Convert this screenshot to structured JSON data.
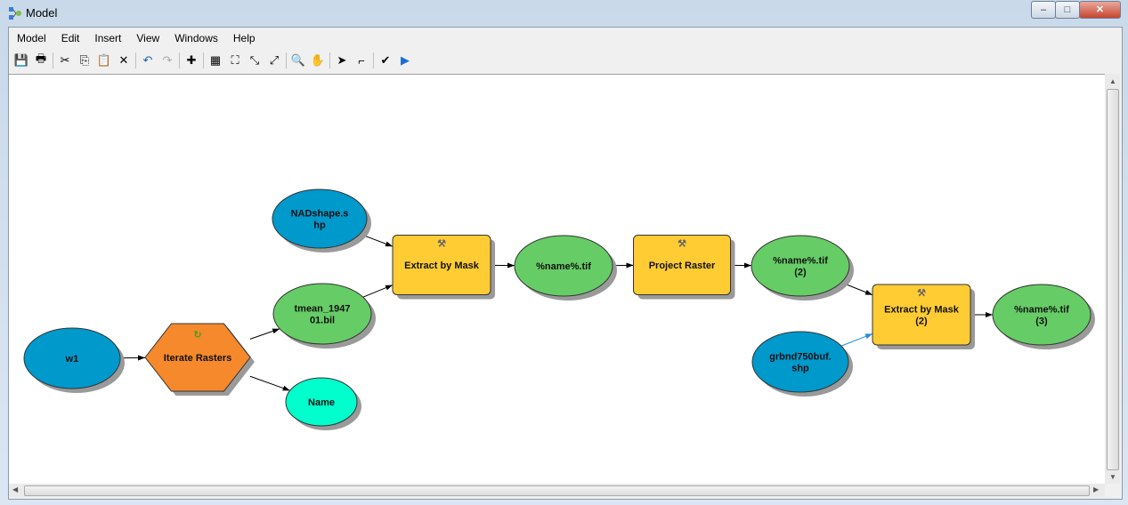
{
  "window": {
    "title": "Model",
    "minimize": "–",
    "maximize": "□",
    "close": "✕"
  },
  "menu": [
    "Model",
    "Edit",
    "Insert",
    "View",
    "Windows",
    "Help"
  ],
  "toolbar": [
    {
      "icon": "save-icon",
      "glyph": "💾"
    },
    {
      "icon": "print-icon",
      "glyph": "🖶"
    },
    "sep",
    {
      "icon": "cut-icon",
      "glyph": "✂"
    },
    {
      "icon": "copy-icon",
      "glyph": "⎘"
    },
    {
      "icon": "paste-icon",
      "glyph": "📋"
    },
    {
      "icon": "delete-icon",
      "glyph": "✕"
    },
    "sep",
    {
      "icon": "undo-icon",
      "glyph": "↶"
    },
    {
      "icon": "redo-icon",
      "glyph": "↷"
    },
    "sep",
    {
      "icon": "add-data-icon",
      "glyph": "✚"
    },
    "sep",
    {
      "icon": "auto-layout-icon",
      "glyph": "▦"
    },
    {
      "icon": "full-extent-icon",
      "glyph": "⛶"
    },
    {
      "icon": "fixed-zoom-in-icon",
      "glyph": "⤡"
    },
    {
      "icon": "fixed-zoom-out-icon",
      "glyph": "⤢"
    },
    "sep",
    {
      "icon": "zoom-in-icon",
      "glyph": "🔍"
    },
    {
      "icon": "pan-icon",
      "glyph": "✋"
    },
    "sep",
    {
      "icon": "select-icon",
      "glyph": "➤"
    },
    {
      "icon": "connect-icon",
      "glyph": "⌐"
    },
    "sep",
    {
      "icon": "validate-icon",
      "glyph": "✔"
    },
    {
      "icon": "run-icon",
      "glyph": "▶"
    }
  ],
  "colors": {
    "input_data": "#0099CC",
    "derived_data": "#66CC66",
    "tool": "#FFCC33",
    "iterator": "#F5892C",
    "parameter": "#00FFCC"
  },
  "model": {
    "nodes": [
      {
        "id": "w1",
        "type": "input_data",
        "lines": [
          "w1"
        ]
      },
      {
        "id": "iterate",
        "type": "iterator",
        "lines": [
          "Iterate Rasters"
        ]
      },
      {
        "id": "tmean",
        "type": "derived_data",
        "lines": [
          "tmean_1947",
          "01.bil"
        ]
      },
      {
        "id": "name",
        "type": "parameter",
        "lines": [
          "Name"
        ]
      },
      {
        "id": "nadshape",
        "type": "input_data",
        "lines": [
          "NADshape.s",
          "hp"
        ]
      },
      {
        "id": "extract1",
        "type": "tool",
        "lines": [
          "Extract by Mask"
        ]
      },
      {
        "id": "out1",
        "type": "derived_data",
        "lines": [
          "%name%.tif"
        ]
      },
      {
        "id": "project",
        "type": "tool",
        "lines": [
          "Project Raster"
        ]
      },
      {
        "id": "out2",
        "type": "derived_data",
        "lines": [
          "%name%.tif",
          "(2)"
        ]
      },
      {
        "id": "extract2",
        "type": "tool",
        "lines": [
          "Extract by Mask",
          "(2)"
        ]
      },
      {
        "id": "grbnd",
        "type": "input_data",
        "lines": [
          "grbnd750buf.",
          "shp"
        ]
      },
      {
        "id": "out3",
        "type": "derived_data",
        "lines": [
          "%name%.tif",
          "(3)"
        ]
      }
    ],
    "connections": [
      [
        "w1",
        "iterate"
      ],
      [
        "iterate",
        "tmean"
      ],
      [
        "iterate",
        "name"
      ],
      [
        "nadshape",
        "extract1"
      ],
      [
        "tmean",
        "extract1"
      ],
      [
        "extract1",
        "out1"
      ],
      [
        "out1",
        "project"
      ],
      [
        "project",
        "out2"
      ],
      [
        "out2",
        "extract2"
      ],
      [
        "grbnd",
        "extract2"
      ],
      [
        "extract2",
        "out3"
      ]
    ]
  }
}
